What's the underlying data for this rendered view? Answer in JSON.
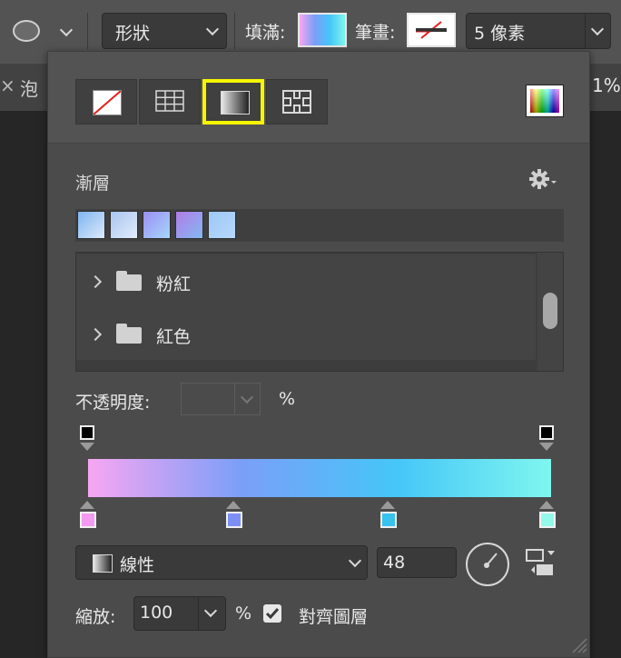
{
  "toolbar": {
    "shape_mode": "形狀",
    "fill_label": "填滿:",
    "stroke_label": "筆畫:",
    "stroke_width": "5 像素",
    "fill_gradient": [
      "#f7a6f2",
      "#7a9ff8",
      "#45c6f8",
      "#7ff6ef"
    ]
  },
  "background": {
    "tab_text": "泡",
    "zoom_text": "1%"
  },
  "panel": {
    "section_title": "漸層",
    "presets": [
      [
        "#7fb4ee",
        "#dceafc"
      ],
      [
        "#a9c5f0",
        "#e2ecfa"
      ],
      [
        "#9b8ef5",
        "#a6d7fa"
      ],
      [
        "#b07ce8",
        "#85b8f2"
      ],
      [
        "#9dc8f6",
        "#b8d8fb"
      ]
    ],
    "folders": [
      {
        "name": "粉紅"
      },
      {
        "name": "紅色"
      }
    ],
    "opacity_label": "不透明度:",
    "opacity_unit": "%",
    "gradient_bar": [
      "#f7a6f2",
      "#7a9ff8",
      "#45c6f8",
      "#7ff6ef"
    ],
    "color_stops": [
      "#f49af0",
      "#7d8ef4",
      "#37c3ee",
      "#95f8ec"
    ],
    "opacity_stops": [
      "#000000",
      "#000000"
    ],
    "style_value": "線性",
    "angle_value": "48",
    "scale_label": "縮放:",
    "scale_value": "100",
    "scale_unit": "%",
    "align_label": "對齊圖層",
    "align_checked": true
  }
}
